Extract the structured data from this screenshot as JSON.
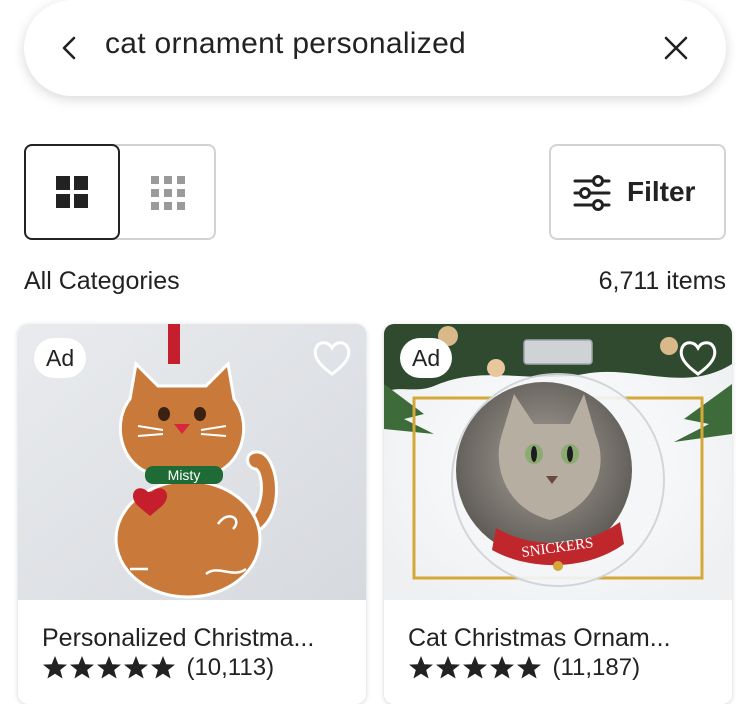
{
  "search": {
    "query": "cat ornament personalized"
  },
  "toolbar": {
    "filter_label": "Filter"
  },
  "results": {
    "category": "All Categories",
    "count": "6,711 items"
  },
  "listings": [
    {
      "ad_label": "Ad",
      "title": "Personalized Christma...",
      "rating": 5,
      "reviews": "(10,113)",
      "image_text": "Misty"
    },
    {
      "ad_label": "Ad",
      "title": "Cat Christmas Ornam...",
      "rating": 5,
      "reviews": "(11,187)",
      "image_text": "SNICKERS"
    }
  ],
  "colors": {
    "text": "#222222",
    "border": "#d3d3d3",
    "selected_border": "#222222"
  }
}
